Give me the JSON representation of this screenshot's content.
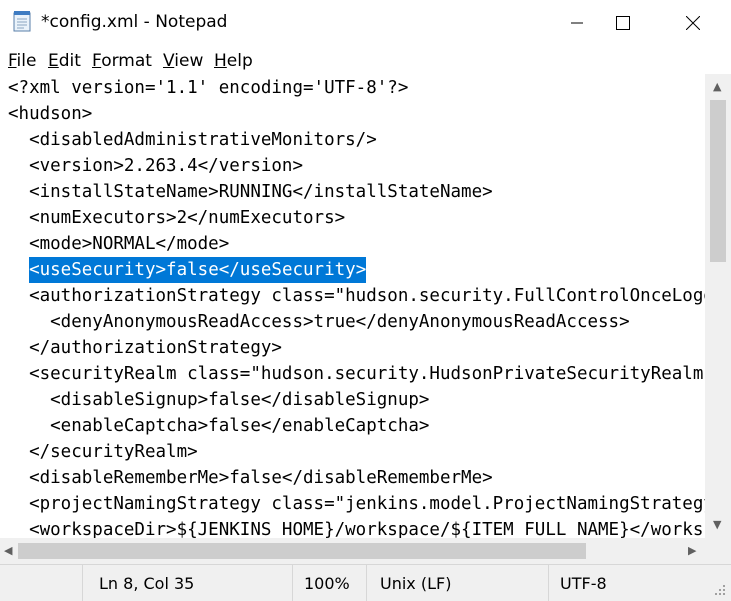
{
  "window": {
    "title": "*config.xml - Notepad"
  },
  "menu": {
    "items": [
      "File",
      "Edit",
      "Format",
      "View",
      "Help"
    ]
  },
  "editor": {
    "lines": [
      "<?xml version='1.1' encoding='UTF-8'?>",
      "<hudson>",
      "  <disabledAdministrativeMonitors/>",
      "  <version>2.263.4</version>",
      "  <installStateName>RUNNING</installStateName>",
      "  <numExecutors>2</numExecutors>",
      "  <mode>NORMAL</mode>",
      "  <useSecurity>false</useSecurity>",
      "  <authorizationStrategy class=\"hudson.security.FullControlOnceLoggedInAuthorizationStrategy\">",
      "    <denyAnonymousReadAccess>true</denyAnonymousReadAccess>",
      "  </authorizationStrategy>",
      "  <securityRealm class=\"hudson.security.HudsonPrivateSecurityRealm\">",
      "    <disableSignup>false</disableSignup>",
      "    <enableCaptcha>false</enableCaptcha>",
      "  </securityRealm>",
      "  <disableRememberMe>false</disableRememberMe>",
      "  <projectNamingStrategy class=\"jenkins.model.ProjectNamingStrategy$DefaultProjectNamingStrategy\"/>",
      "  <workspaceDir>${JENKINS_HOME}/workspace/${ITEM_FULL_NAME}</workspaceDir>"
    ],
    "selected_line_index": 7,
    "selected_text": "<useSecurity>false</useSecurity>"
  },
  "status": {
    "position": "Ln 8, Col 35",
    "zoom": "100%",
    "line_ending": "Unix (LF)",
    "encoding": "UTF-8"
  },
  "colors": {
    "selection": "#0078d7",
    "chrome": "#f0f0f0"
  }
}
